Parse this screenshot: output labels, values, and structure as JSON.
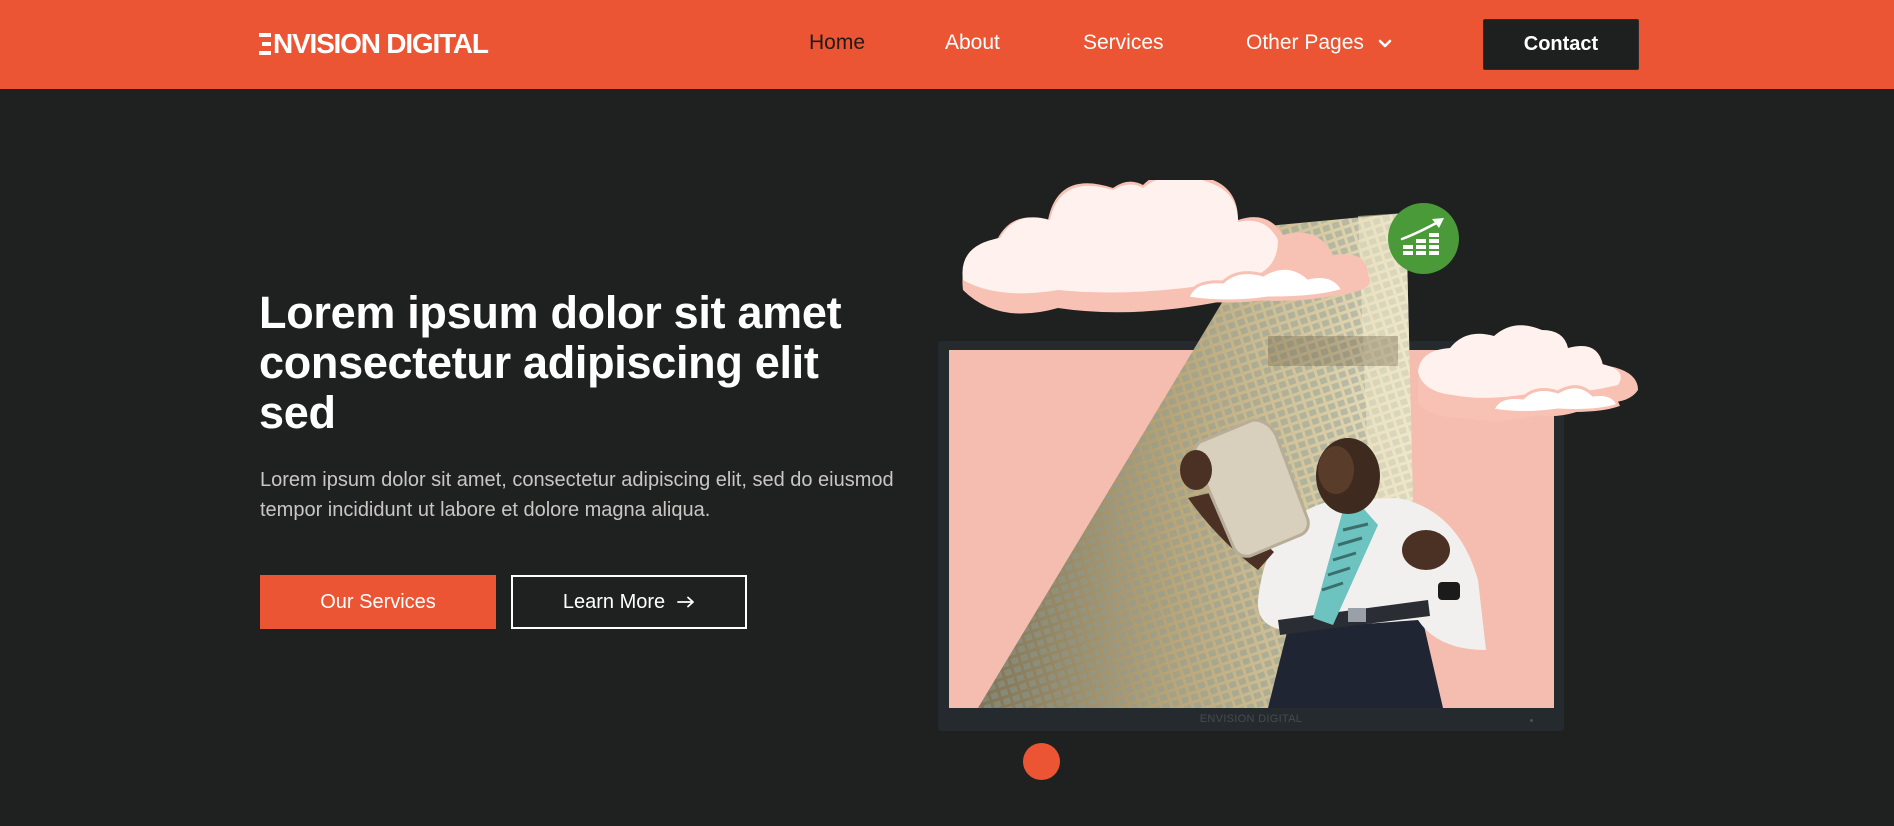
{
  "brand": {
    "name": "NVISION DIGITAL",
    "monitor_label": "ENVISION DIGITAL"
  },
  "nav": {
    "items": [
      {
        "label": "Home",
        "active": true
      },
      {
        "label": "About"
      },
      {
        "label": "Services"
      },
      {
        "label": "Other Pages"
      }
    ],
    "contact_label": "Contact"
  },
  "hero": {
    "title": "Lorem ipsum dolor sit amet consectetur adipiscing elit sed",
    "subtitle": "Lorem ipsum dolor sit amet, consectetur adipiscing elit, sed do eiusmod tempor incididunt ut labore et dolore magna aliqua.",
    "primary_button": "Our Services",
    "secondary_button": "Learn More"
  },
  "icons": {
    "logo": "e-bars-icon",
    "dropdown": "chevron-down-icon",
    "learn_more": "arrow-right-icon",
    "badge": "growth-chart-icon"
  },
  "colors": {
    "accent": "#eb5533",
    "background": "#1f2121",
    "badge": "#4a9a3a",
    "screen": "#f5bdb0"
  },
  "slider": {
    "active_index": 1,
    "total": 1
  }
}
